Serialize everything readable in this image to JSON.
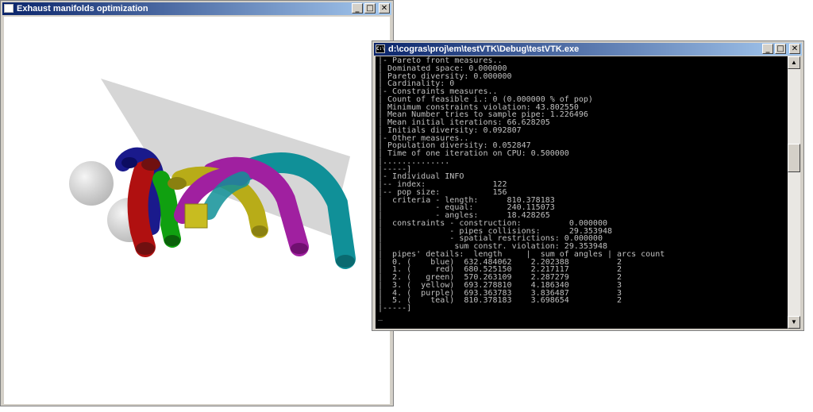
{
  "window_3d": {
    "title": "Exhaust manifolds optimization",
    "buttons": {
      "minimize": "_",
      "maximize": "□",
      "close": "✕"
    }
  },
  "scene": {
    "pipe_colors": {
      "blue": "#1a1a8c",
      "red": "#b01010",
      "green": "#10a010",
      "yellow": "#b8ac18",
      "purple": "#a020a0",
      "teal": "#109098"
    },
    "plane_color": "#d2d2d2",
    "sphere_color": "#c8c8c8"
  },
  "console": {
    "title": "d:\\cogras\\proj\\em\\testVTK\\Debug\\testVTK.exe",
    "buttons": {
      "minimize": "_",
      "maximize": "□",
      "close": "✕"
    },
    "lines": [
      "|- Pareto front measures..",
      "| Dominated space: 0.000000",
      "| Pareto diversity: 0.000000",
      "| Cardinality: 0",
      "|- Constraints measures..",
      "| Count of feasible i.: 0 (0.000000 % of pop)",
      "| Minimum constraints violation: 43.802550",
      "| Mean Number tries to sample pipe: 1.226496",
      "| Mean initial iterations: 66.628205",
      "| Initials diversity: 0.092807",
      "|- Other measures..",
      "| Population diversity: 0.052847",
      "| Time of one iteration on CPU: 0.500000",
      "|..............",
      "|-----]",
      "|- Individual INFO",
      "|-- index:              122",
      "|-- pop size:           156",
      "|  criteria - length:      810.378183",
      "|           - equal:       240.115073",
      "|           - angles:      18.428265",
      "|  constraints - construction:          0.000000",
      "|              - pipes collisions:      29.353948",
      "|              - spatial restrictions: 0.000000",
      "|               sum constr. violation: 29.353948",
      "|  pipes' details:  length     |  sum of angles | arcs count",
      "|  0. (    blue)  632.484062    2.202388          2",
      "|  1. (     red)  680.525150    2.217117          2",
      "|  2. (   green)  570.263109    2.287279          2",
      "|  3. (  yellow)  693.278810    4.186340          3",
      "|  4. (  purple)  693.363783    3.836487          3",
      "|  5. (    teal)  810.378183    3.698654          2",
      "|-----]",
      "_"
    ]
  }
}
